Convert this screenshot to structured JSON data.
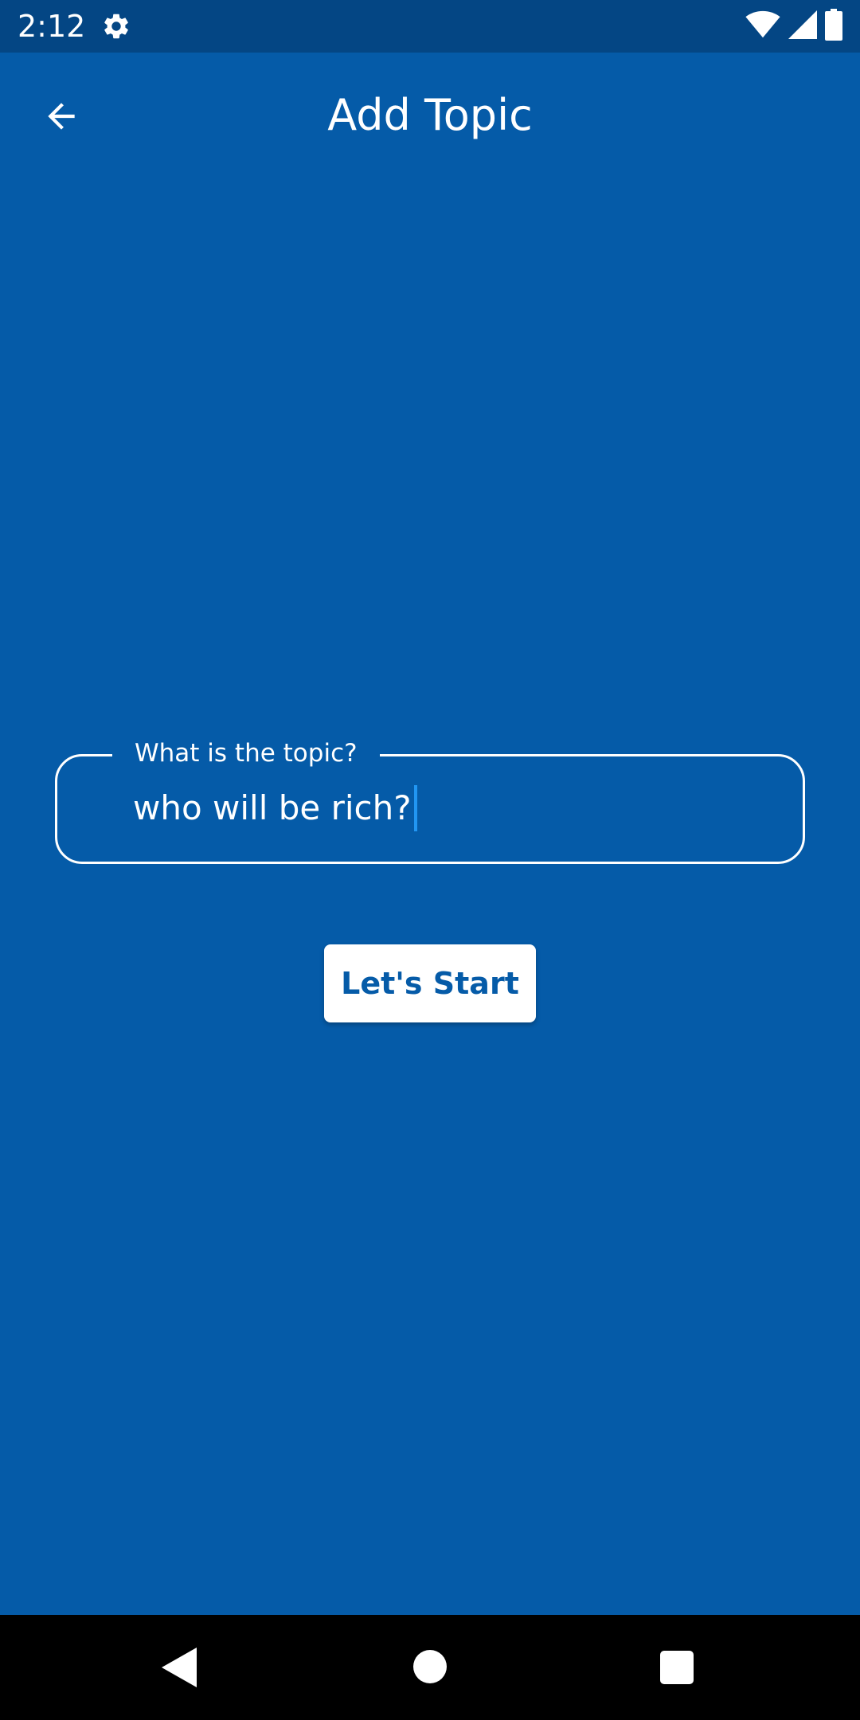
{
  "status_bar": {
    "time": "2:12",
    "icons": [
      "gear-icon",
      "wifi-icon",
      "signal-icon",
      "battery-icon"
    ]
  },
  "app_bar": {
    "title": "Add Topic",
    "back_icon": "arrow-left-icon"
  },
  "topic_field": {
    "label": "What is the topic?",
    "value": "who will be rich?"
  },
  "start_button": {
    "label": "Let's Start"
  },
  "nav_bar": {
    "icons": [
      "back-triangle-icon",
      "home-circle-icon",
      "recents-square-icon"
    ]
  },
  "colors": {
    "background": "#055ba8",
    "status_bar": "#044684",
    "button_text": "#055ba8",
    "caret": "#2196f3"
  }
}
